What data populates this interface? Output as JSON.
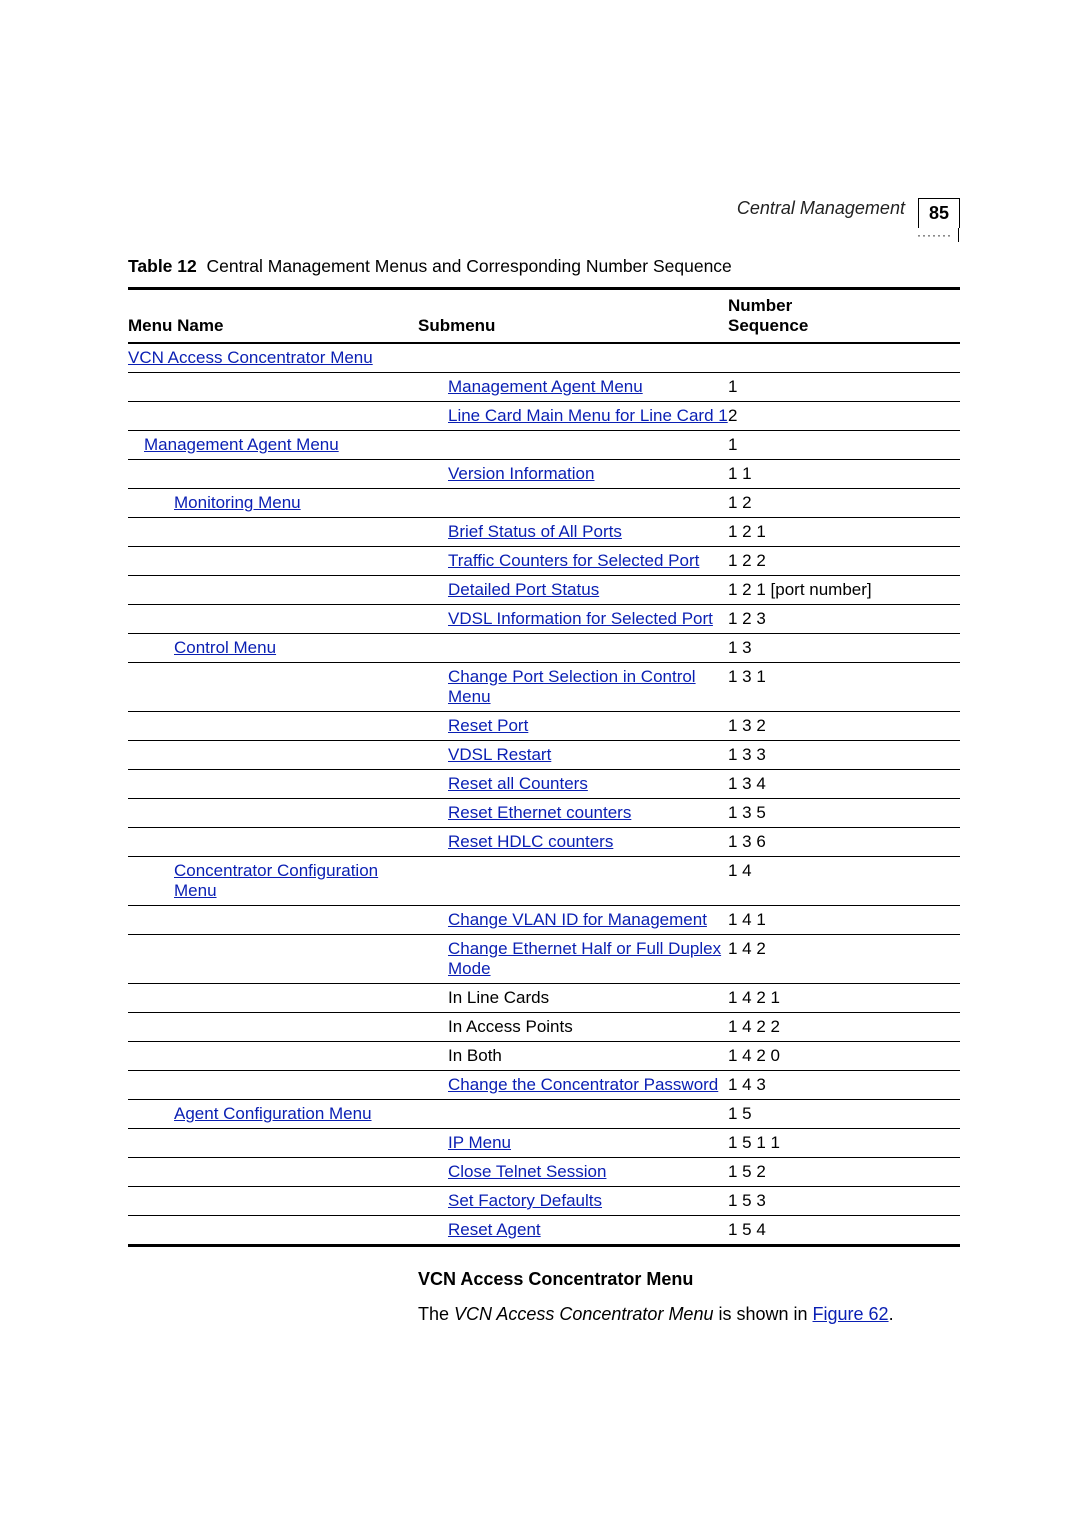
{
  "header": {
    "section": "Central Management",
    "page": "85",
    "dots": "·······"
  },
  "caption": {
    "label": "Table 12",
    "title": "Central Management Menus and Corresponding Number Sequence"
  },
  "columns": {
    "c1": "Menu Name",
    "c2": "Submenu",
    "c3a": "Number",
    "c3b": "Sequence"
  },
  "rows": [
    {
      "m": {
        "text": "VCN Access Concentrator Menu",
        "link": true,
        "indent": 0
      },
      "s": null,
      "n": ""
    },
    {
      "m": null,
      "s": {
        "text": "Management Agent Menu",
        "link": true,
        "indent": 1
      },
      "n": "1"
    },
    {
      "m": null,
      "s": {
        "text": "Line Card Main Menu for Line Card 1",
        "link": true,
        "indent": 1
      },
      "n": "2"
    },
    {
      "m": {
        "text": "Management Agent Menu",
        "link": true,
        "indent": 1
      },
      "s": null,
      "n": "1"
    },
    {
      "m": null,
      "s": {
        "text": "Version Information",
        "link": true,
        "indent": 2
      },
      "n": "1 1"
    },
    {
      "m": {
        "text": "Monitoring Menu",
        "link": true,
        "indent": 2
      },
      "s": null,
      "n": "1 2"
    },
    {
      "m": null,
      "s": {
        "text": "Brief Status of All Ports",
        "link": true,
        "indent": 2
      },
      "n": "1 2 1"
    },
    {
      "m": null,
      "s": {
        "text": "Traffic Counters for Selected Port",
        "link": true,
        "indent": 2
      },
      "n": "1 2 2"
    },
    {
      "m": null,
      "s": {
        "text": "Detailed Port Status",
        "link": true,
        "indent": 2
      },
      "n": "1 2 1 [port number]"
    },
    {
      "m": null,
      "s": {
        "text": "VDSL Information for Selected Port",
        "link": true,
        "indent": 2
      },
      "n": "1 2 3"
    },
    {
      "m": {
        "text": "Control Menu",
        "link": true,
        "indent": 2
      },
      "s": null,
      "n": "1 3"
    },
    {
      "m": null,
      "s": {
        "text": "Change Port Selection in Control Menu",
        "link": true,
        "indent": 2
      },
      "n": "1 3 1"
    },
    {
      "m": null,
      "s": {
        "text": "Reset Port",
        "link": true,
        "indent": 2
      },
      "n": "1 3 2"
    },
    {
      "m": null,
      "s": {
        "text": "VDSL Restart",
        "link": true,
        "indent": 2
      },
      "n": "1 3 3"
    },
    {
      "m": null,
      "s": {
        "text": "Reset all Counters",
        "link": true,
        "indent": 2
      },
      "n": "1 3 4"
    },
    {
      "m": null,
      "s": {
        "text": "Reset Ethernet counters",
        "link": true,
        "indent": 2
      },
      "n": "1 3 5"
    },
    {
      "m": null,
      "s": {
        "text": "Reset HDLC counters",
        "link": true,
        "indent": 2
      },
      "n": "1 3 6"
    },
    {
      "m": {
        "text": "Concentrator Configuration Menu",
        "link": true,
        "indent": 2
      },
      "s": null,
      "n": "1 4"
    },
    {
      "m": null,
      "s": {
        "text": "Change VLAN ID for Management",
        "link": true,
        "indent": 2
      },
      "n": "1 4 1"
    },
    {
      "m": null,
      "s": {
        "text": "Change Ethernet Half or Full Duplex Mode",
        "link": true,
        "indent": 2
      },
      "n": "1 4 2"
    },
    {
      "m": null,
      "s": {
        "text": "In Line Cards",
        "link": false,
        "indent": 2
      },
      "n": "1 4 2 1"
    },
    {
      "m": null,
      "s": {
        "text": "In Access Points",
        "link": false,
        "indent": 2
      },
      "n": "1 4 2 2"
    },
    {
      "m": null,
      "s": {
        "text": "In Both",
        "link": false,
        "indent": 2
      },
      "n": "1 4 2 0"
    },
    {
      "m": null,
      "s": {
        "text": "Change the Concentrator Password",
        "link": true,
        "indent": 2
      },
      "n": "1 4 3"
    },
    {
      "m": {
        "text": "Agent Configuration Menu",
        "link": true,
        "indent": 2
      },
      "s": null,
      "n": "1 5"
    },
    {
      "m": null,
      "s": {
        "text": "IP Menu",
        "link": true,
        "indent": 2
      },
      "n": "1 5 1 1"
    },
    {
      "m": null,
      "s": {
        "text": "Close Telnet Session",
        "link": true,
        "indent": 2
      },
      "n": "1 5 2"
    },
    {
      "m": null,
      "s": {
        "text": "Set Factory Defaults",
        "link": true,
        "indent": 2
      },
      "n": "1 5 3"
    },
    {
      "m": null,
      "s": {
        "text": "Reset Agent",
        "link": true,
        "indent": 2
      },
      "n": "1 5 4"
    }
  ],
  "section": {
    "title": "VCN Access Concentrator Menu",
    "p1_a": "The ",
    "p1_i": "VCN Access Concentrator Menu",
    "p1_b": " is shown in ",
    "p1_link": "Figure 62",
    "p1_c": "."
  }
}
